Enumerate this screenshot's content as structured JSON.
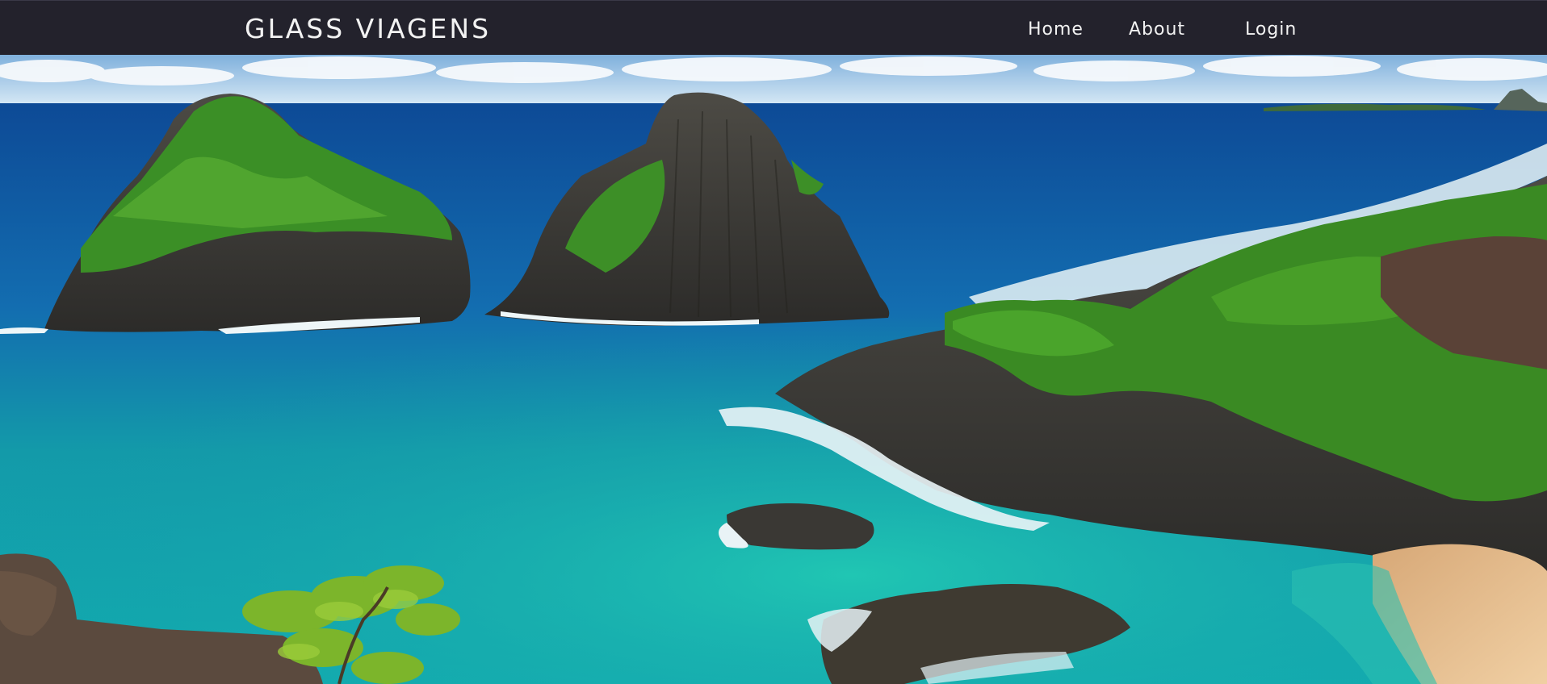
{
  "header": {
    "brand": "GLASS VIAGENS",
    "nav": [
      {
        "label": "Home"
      },
      {
        "label": "About"
      },
      {
        "label": "Login"
      }
    ]
  },
  "hero": {
    "image": "tropical-bay-photo",
    "colors": {
      "sky": "#cfe3f2",
      "deep_sea": "#1456a0",
      "shallow_sea": "#17b3ad",
      "vegetation": "#3e8e24",
      "rock": "#3c3a36",
      "sand": "#e3b98a"
    }
  }
}
